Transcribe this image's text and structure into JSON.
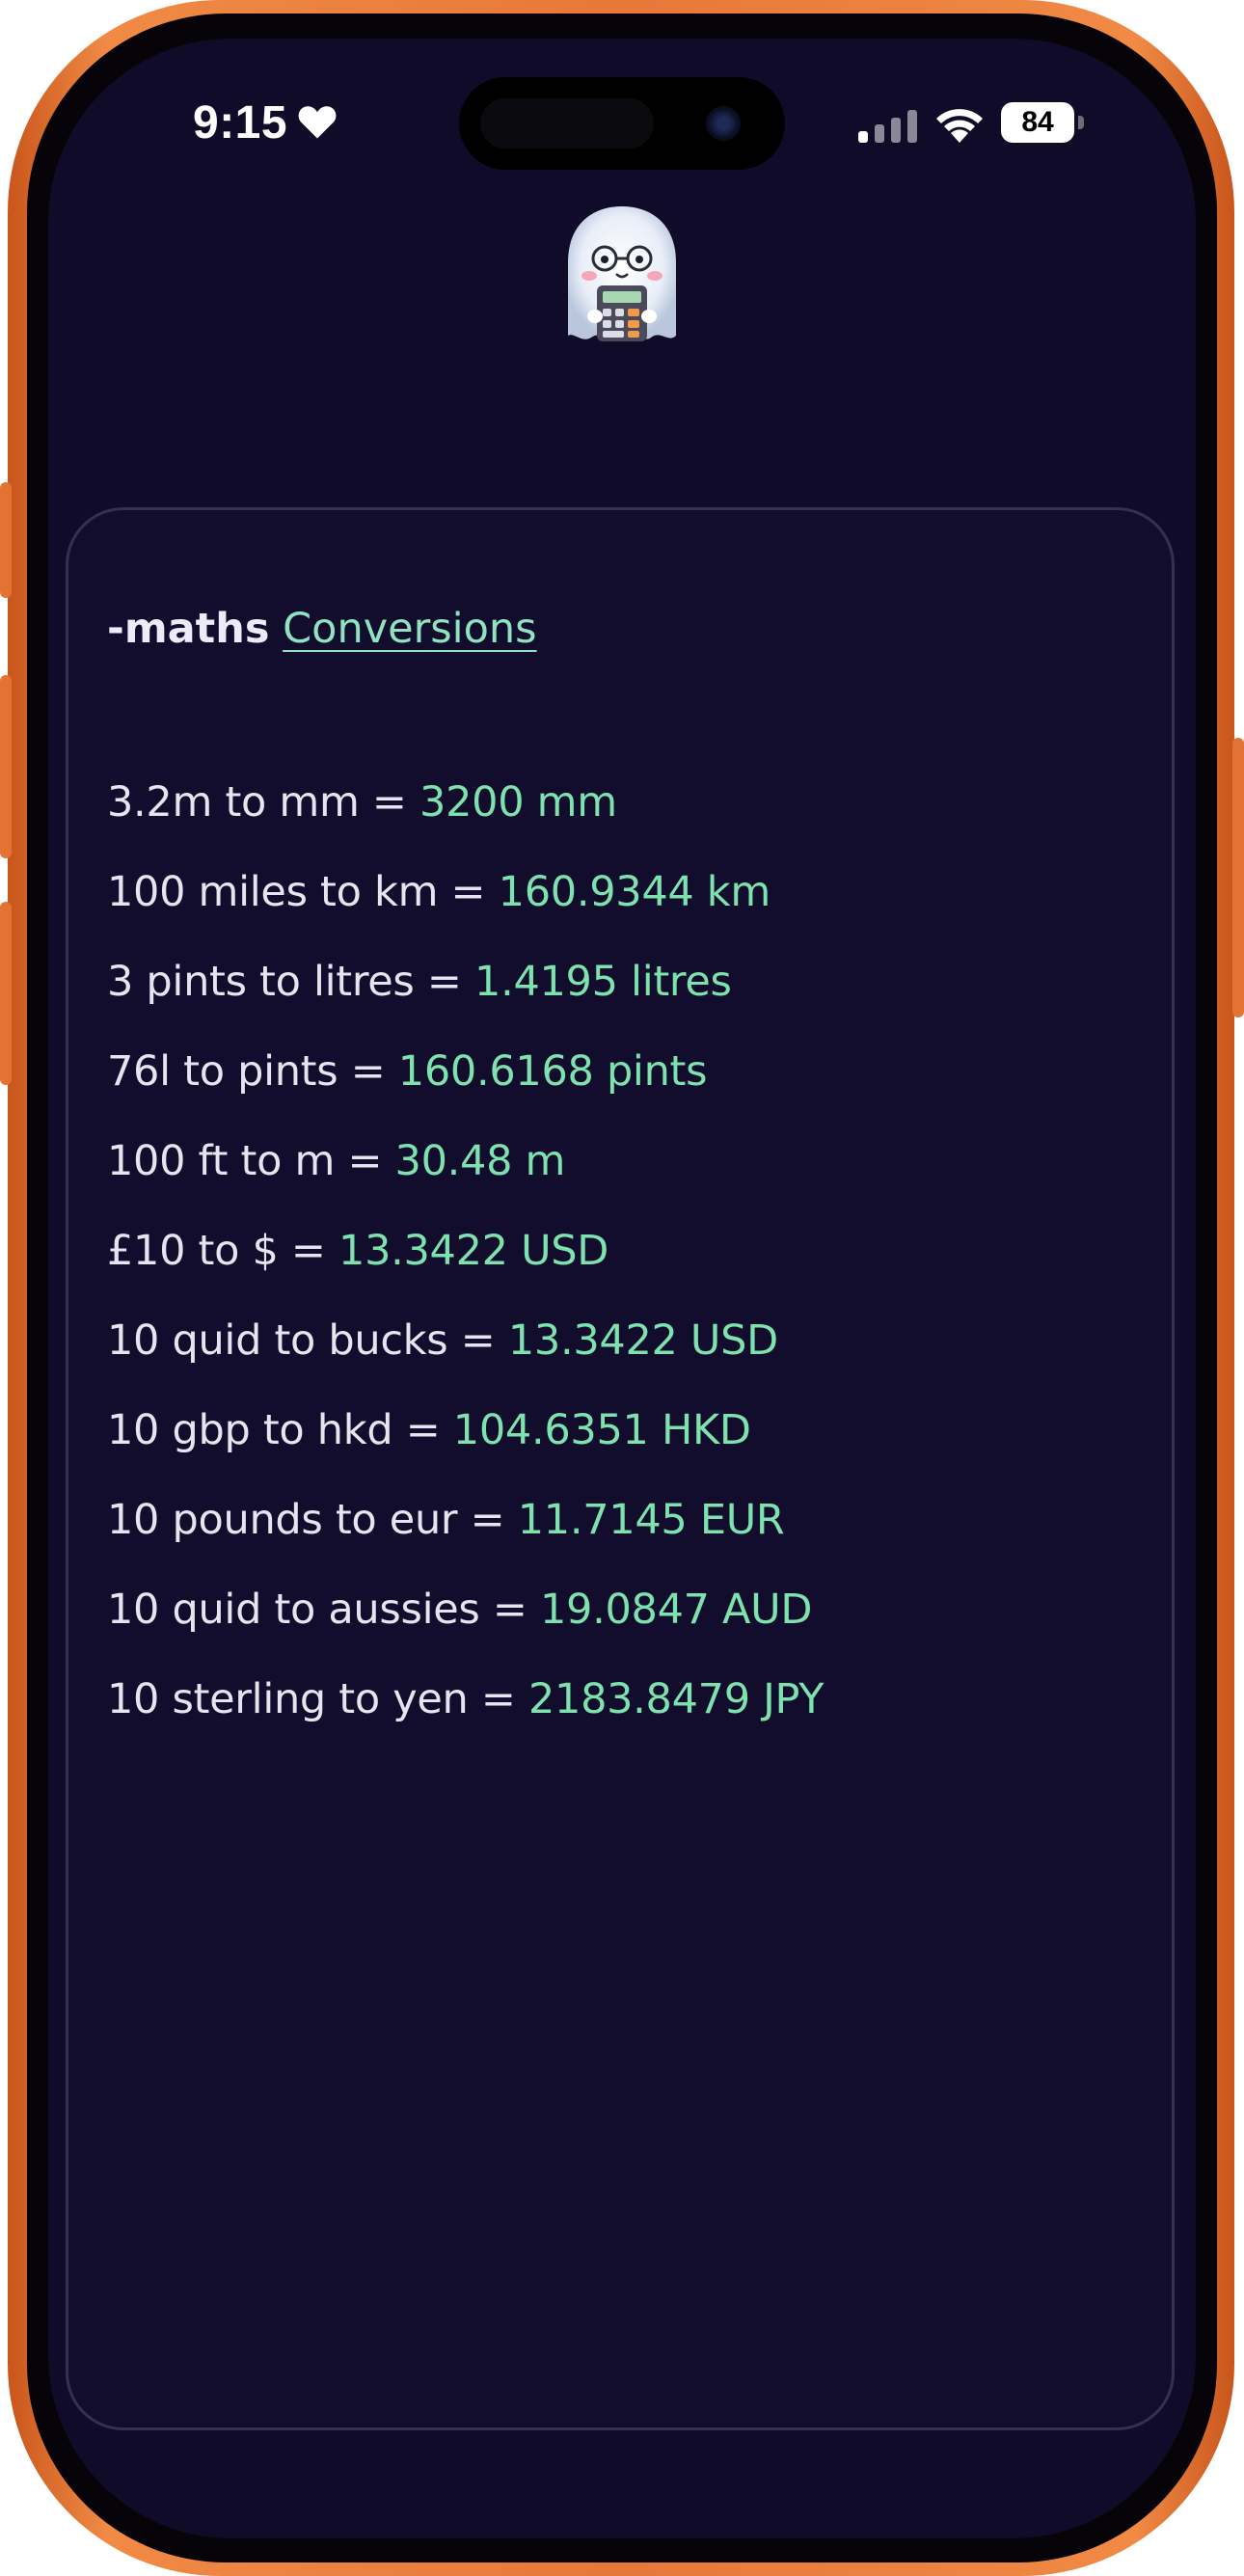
{
  "status_bar": {
    "time": "9:15",
    "battery": "84"
  },
  "app": {
    "logo_icon": "ghost-calculator-icon"
  },
  "card": {
    "command": "-maths",
    "link": "Conversions"
  },
  "conversions": [
    {
      "query": "3.2m to mm = ",
      "result": "3200 mm"
    },
    {
      "query": "100 miles to km = ",
      "result": "160.9344 km"
    },
    {
      "query": "3 pints to litres = ",
      "result": "1.4195 litres"
    },
    {
      "query": "76l to pints = ",
      "result": "160.6168 pints"
    },
    {
      "query": "100 ft to m = ",
      "result": "30.48 m"
    },
    {
      "query": "£10 to $ = ",
      "result": "13.3422 USD"
    },
    {
      "query": "10 quid to bucks = ",
      "result": "13.3422 USD"
    },
    {
      "query": "10 gbp to hkd = ",
      "result": "104.6351 HKD"
    },
    {
      "query": "10 pounds to eur = ",
      "result": "11.7145 EUR"
    },
    {
      "query": "10 quid to aussies = ",
      "result": "19.0847 AUD"
    },
    {
      "query": "10 sterling to yen = ",
      "result": "2183.8479 JPY"
    }
  ],
  "colors": {
    "frame": "#e8773a",
    "background": "#110b2a",
    "result": "#7de2ae",
    "link": "#8fe3c0"
  }
}
